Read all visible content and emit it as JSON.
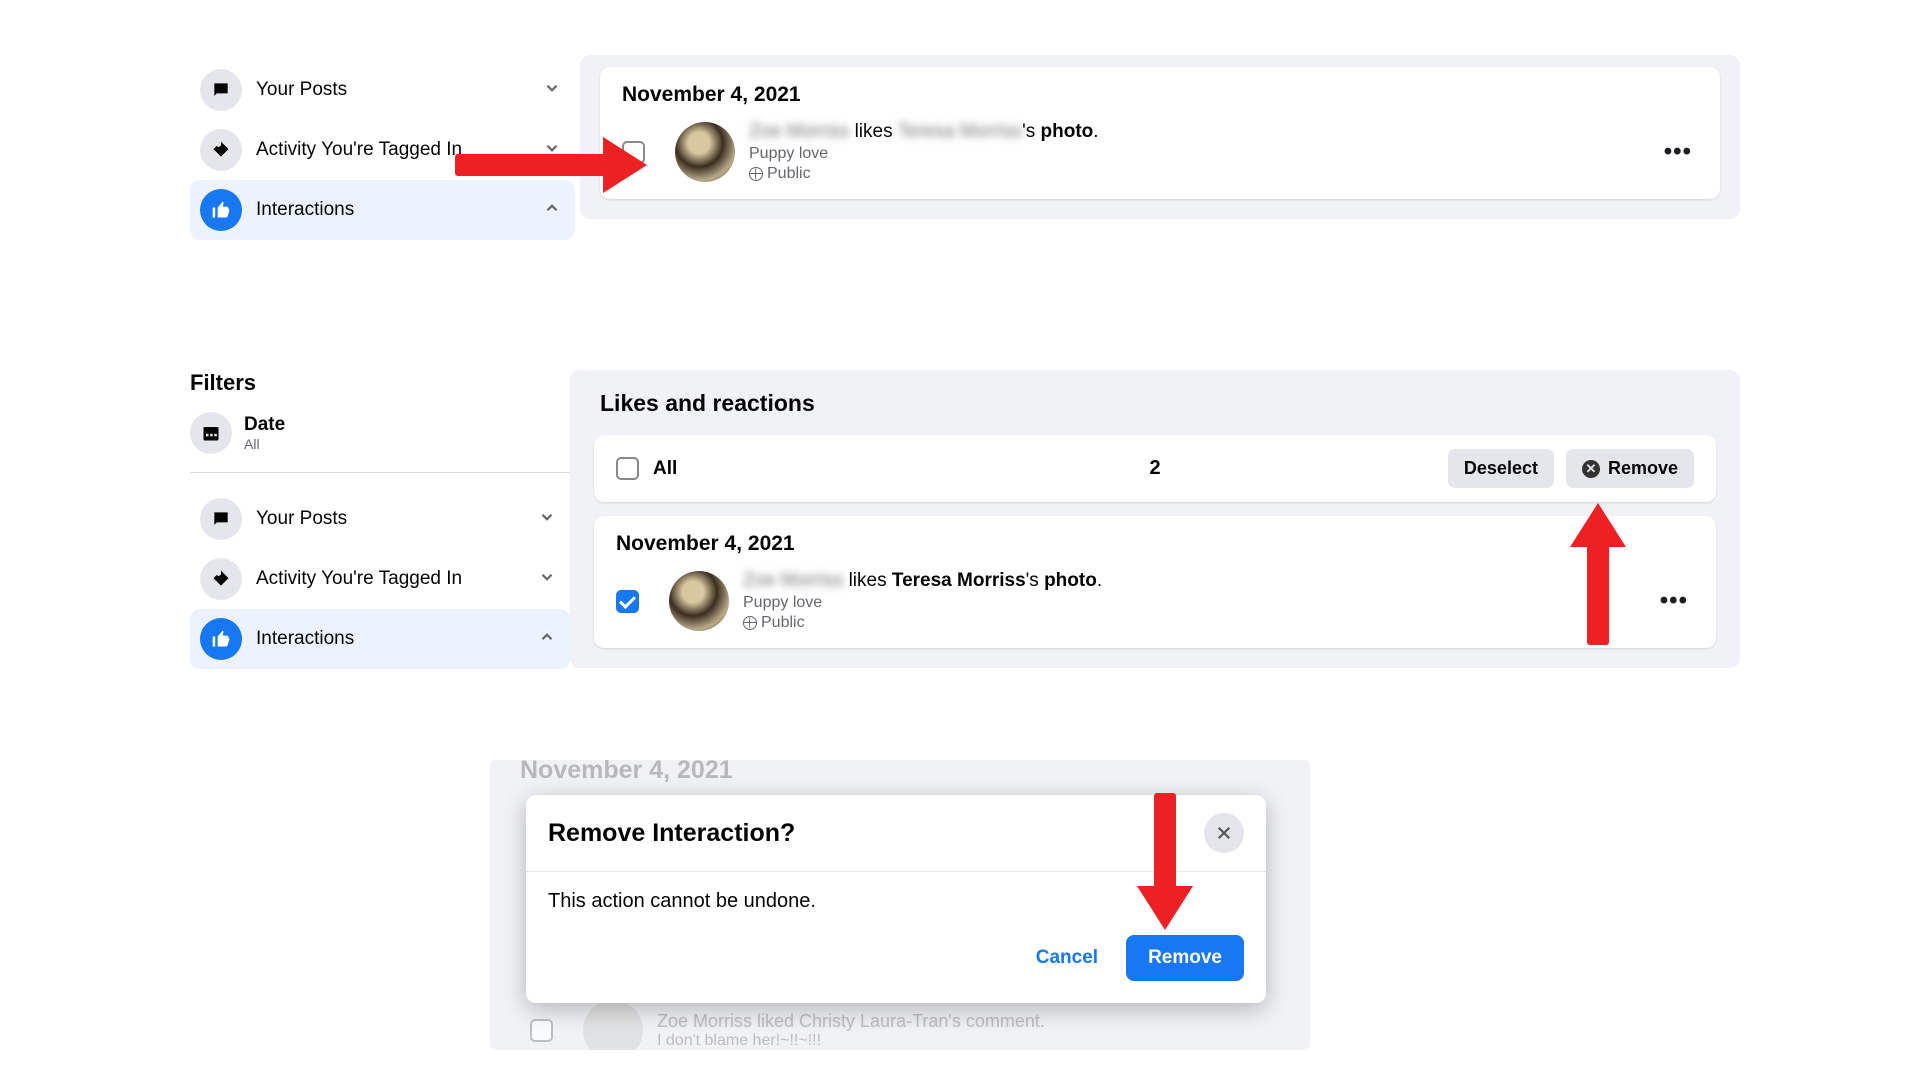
{
  "sidebar": {
    "items": [
      {
        "label": "Your Posts",
        "icon": "chat-icon"
      },
      {
        "label": "Activity You're Tagged In",
        "icon": "tag-icon"
      },
      {
        "label": "Interactions",
        "icon": "thumbs-up-icon"
      }
    ]
  },
  "filters": {
    "title": "Filters",
    "date_label": "Date",
    "date_value": "All"
  },
  "panel1": {
    "date": "November 4, 2021",
    "entry": {
      "name1": "Zoe Morriss",
      "middle": " likes ",
      "name2": "Teresa Morriss",
      "suffix": "'s ",
      "object": "photo",
      "tail": ".",
      "subtitle": "Puppy love",
      "privacy": "Public"
    }
  },
  "panel2": {
    "section_title": "Likes and reactions",
    "all_label": "All",
    "count": "2",
    "deselect": "Deselect",
    "remove": "Remove",
    "date": "November 4, 2021",
    "entry": {
      "name1": "Zoe Morriss",
      "middle": " likes ",
      "name2": "Teresa Morriss",
      "suffix": "'s ",
      "object": "photo",
      "tail": ".",
      "subtitle": "Puppy love",
      "privacy": "Public"
    }
  },
  "panel3": {
    "bg_date": "November 4, 2021",
    "bg_line1": "Zoe Morriss liked Christy Laura-Tran's comment.",
    "bg_line2": "I don't blame her!~!!~!!!",
    "dialog": {
      "title": "Remove Interaction?",
      "body": "This action cannot be undone.",
      "cancel": "Cancel",
      "remove": "Remove"
    }
  }
}
